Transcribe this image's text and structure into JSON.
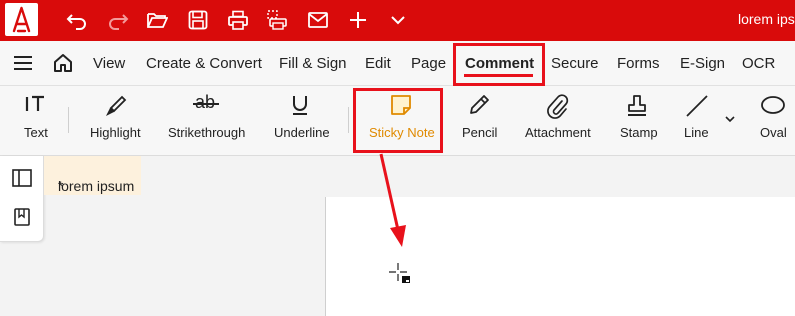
{
  "window": {
    "title": "lorem ips"
  },
  "quick_toolbar": {
    "icons": [
      "undo-icon",
      "redo-icon",
      "open-folder-icon",
      "save-icon",
      "print-icon",
      "print-area-icon",
      "email-icon",
      "plus-icon",
      "chevron-down-icon"
    ]
  },
  "menu": {
    "items": [
      "View",
      "Create & Convert",
      "Fill & Sign",
      "Edit",
      "Page",
      "Comment",
      "Secure",
      "Forms",
      "E-Sign",
      "OCR"
    ],
    "active": "Comment"
  },
  "tools": {
    "text": "Text",
    "highlight": "Highlight",
    "strikethrough": "Strikethrough",
    "strike_glyph": "ab",
    "underline": "Underline",
    "sticky_note": "Sticky Note",
    "pencil": "Pencil",
    "attachment": "Attachment",
    "stamp": "Stamp",
    "line": "Line",
    "oval": "Oval",
    "active": "Sticky Note"
  },
  "document": {
    "tab_label": "lorem ipsum",
    "tab_modified_marker": "*"
  },
  "colors": {
    "brand": "#d90b0b",
    "annotation": "#e8111b",
    "sticky_active": "#e08a00",
    "tab_bg": "#fdf1dd"
  }
}
